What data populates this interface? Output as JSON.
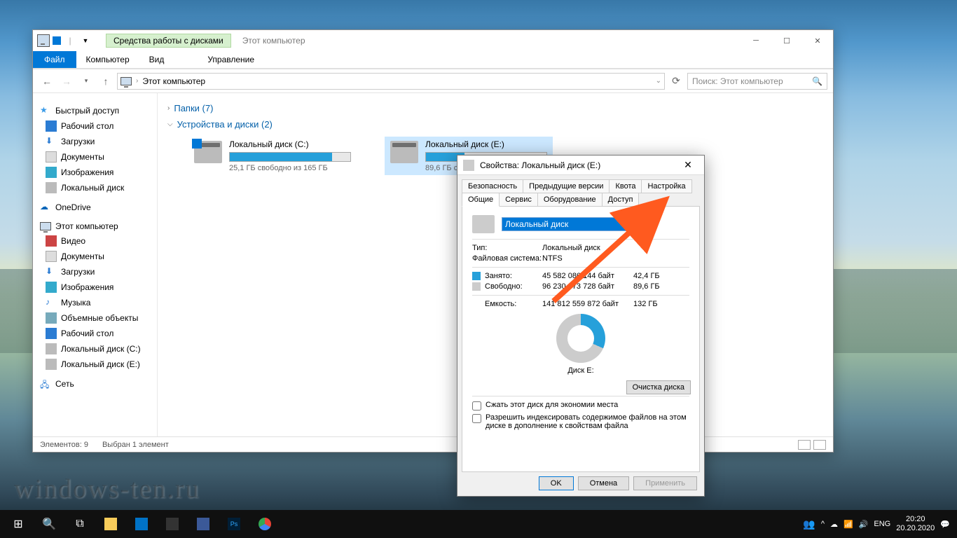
{
  "explorer": {
    "tools_tab": "Средства работы с дисками",
    "title": "Этот компьютер",
    "tabs": {
      "file": "Файл",
      "computer": "Компьютер",
      "view": "Вид",
      "manage": "Управление"
    },
    "nav": {
      "path": "Этот компьютер",
      "search_placeholder": "Поиск: Этот компьютер"
    },
    "sidebar": {
      "quick": "Быстрый доступ",
      "items1": [
        "Рабочий стол",
        "Загрузки",
        "Документы",
        "Изображения",
        "Локальный диск"
      ],
      "onedrive": "OneDrive",
      "thispc": "Этот компьютер",
      "items2": [
        "Видео",
        "Документы",
        "Загрузки",
        "Изображения",
        "Музыка",
        "Объемные объекты",
        "Рабочий стол",
        "Локальный диск (C:)",
        "Локальный диск (E:)"
      ],
      "network": "Сеть"
    },
    "sections": {
      "folders": "Папки (7)",
      "devices": "Устройства и диски (2)"
    },
    "drives": [
      {
        "name": "Локальный диск (C:)",
        "free": "25,1 ГБ свободно из 165 ГБ",
        "fill": 85
      },
      {
        "name": "Локальный диск (E:)",
        "free": "89,6 ГБ свобод...",
        "fill": 32
      }
    ],
    "status": {
      "items": "Элементов: 9",
      "selected": "Выбран 1 элемент"
    }
  },
  "props": {
    "title": "Свойства: Локальный диск (E:)",
    "tabs_row1": [
      "Безопасность",
      "Предыдущие версии",
      "Квота",
      "Настройка"
    ],
    "tabs_row2": [
      "Общие",
      "Сервис",
      "Оборудование",
      "Доступ"
    ],
    "name_value": "Локальный диск",
    "type_lbl": "Тип:",
    "type_val": "Локальный диск",
    "fs_lbl": "Файловая система:",
    "fs_val": "NTFS",
    "used_lbl": "Занято:",
    "used_bytes": "45 582 086 144 байт",
    "used_gb": "42,4 ГБ",
    "free_lbl": "Свободно:",
    "free_bytes": "96 230 473 728 байт",
    "free_gb": "89,6 ГБ",
    "cap_lbl": "Емкость:",
    "cap_bytes": "141 812 559 872 байт",
    "cap_gb": "132 ГБ",
    "pie_label": "Диск E:",
    "cleanup": "Очистка диска",
    "chk1": "Сжать этот диск для экономии места",
    "chk2": "Разрешить индексировать содержимое файлов на этом диске в дополнение к свойствам файла",
    "ok": "OK",
    "cancel": "Отмена",
    "apply": "Применить"
  },
  "taskbar": {
    "lang": "ENG",
    "time": "20:20",
    "date": "20.20.2020"
  },
  "watermark": "windows-ten.ru"
}
